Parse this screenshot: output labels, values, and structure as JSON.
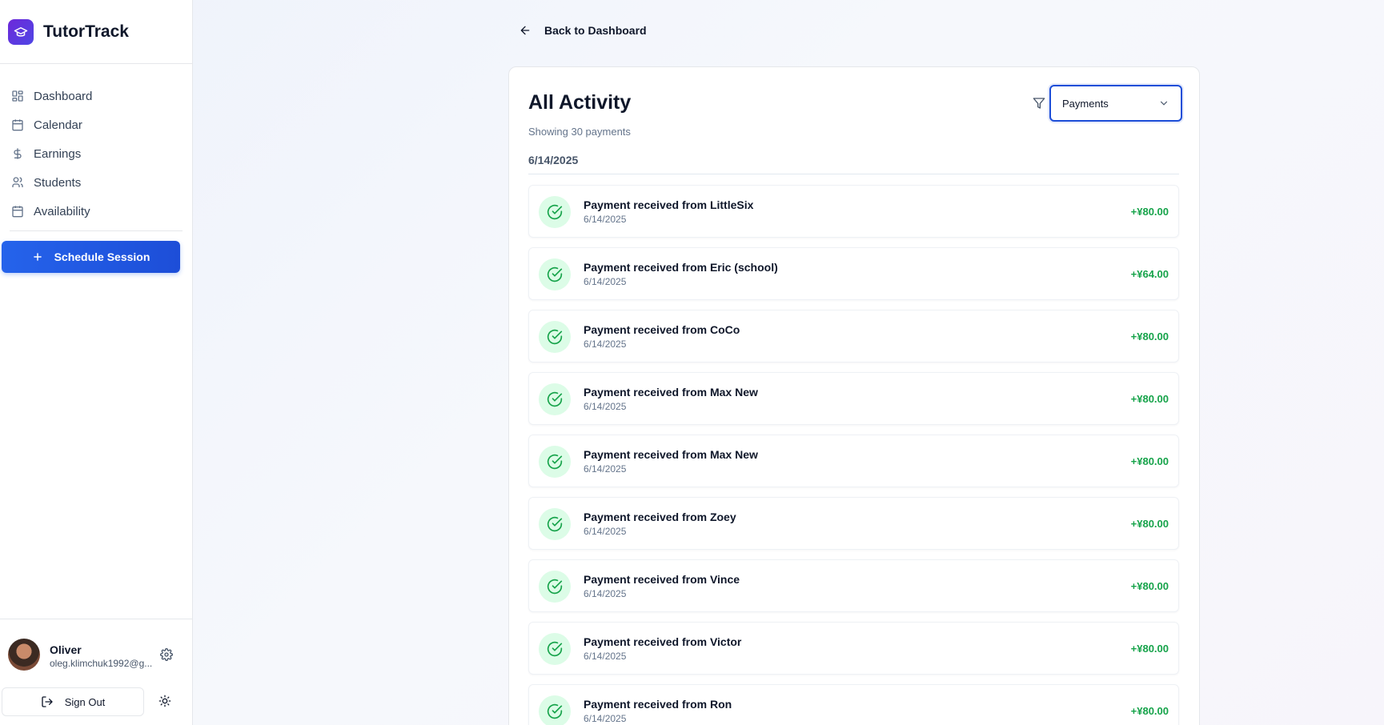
{
  "app": {
    "name": "TutorTrack"
  },
  "sidebar": {
    "items": [
      {
        "label": "Dashboard",
        "icon": "dashboard-grid-icon"
      },
      {
        "label": "Calendar",
        "icon": "calendar-icon"
      },
      {
        "label": "Earnings",
        "icon": "dollar-icon"
      },
      {
        "label": "Students",
        "icon": "users-icon"
      },
      {
        "label": "Availability",
        "icon": "calendar-icon"
      }
    ],
    "schedule_label": "Schedule Session"
  },
  "user": {
    "name": "Oliver",
    "email": "oleg.klimchuk1992@g...",
    "sign_out_label": "Sign Out"
  },
  "main": {
    "back_label": "Back to Dashboard",
    "title": "All Activity",
    "subtitle": "Showing 30 payments",
    "filter": {
      "selected": "Payments"
    },
    "date_group": "6/14/2025",
    "rows": [
      {
        "title": "Payment received from LittleSix",
        "date": "6/14/2025",
        "amount": "+¥80.00"
      },
      {
        "title": "Payment received from Eric (school)",
        "date": "6/14/2025",
        "amount": "+¥64.00"
      },
      {
        "title": "Payment received from CoCo",
        "date": "6/14/2025",
        "amount": "+¥80.00"
      },
      {
        "title": "Payment received from Max New",
        "date": "6/14/2025",
        "amount": "+¥80.00"
      },
      {
        "title": "Payment received from Max New",
        "date": "6/14/2025",
        "amount": "+¥80.00"
      },
      {
        "title": "Payment received from Zoey",
        "date": "6/14/2025",
        "amount": "+¥80.00"
      },
      {
        "title": "Payment received from Vince",
        "date": "6/14/2025",
        "amount": "+¥80.00"
      },
      {
        "title": "Payment received from Victor",
        "date": "6/14/2025",
        "amount": "+¥80.00"
      },
      {
        "title": "Payment received from Ron",
        "date": "6/14/2025",
        "amount": "+¥80.00"
      }
    ]
  },
  "colors": {
    "accent": "#1d4ed8",
    "success": "#16a34a",
    "success_bg": "#dcfce7"
  }
}
